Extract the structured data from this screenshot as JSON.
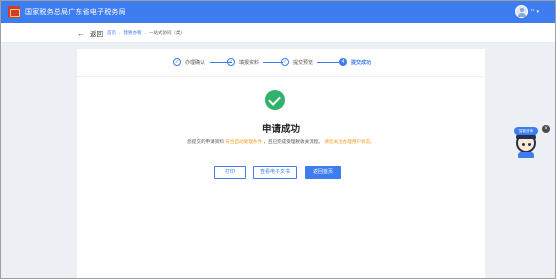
{
  "header": {
    "site_title": "国家税务总局广东省电子税务局",
    "user_name": "**",
    "caret": "▾"
  },
  "subheader": {
    "back_label": "返回",
    "breadcrumbs": [
      "首页",
      "我要办税",
      "一站式协同（类）"
    ]
  },
  "steps": [
    {
      "label": "办理确认",
      "icon": "✓",
      "active": false
    },
    {
      "label": "填报资料",
      "icon": "✓",
      "active": false
    },
    {
      "label": "提交预览",
      "icon": "✓",
      "active": false
    },
    {
      "label": "提交成功",
      "icon": "4",
      "active": true
    }
  ],
  "result": {
    "title": "申请成功",
    "desc_prefix": "您提交的申请资料",
    "desc_highlight1": "符合自动受理条件",
    "desc_middle": "，且已完成受理税收关流程。",
    "desc_highlight2": "请您关注办理用户状态。"
  },
  "buttons": {
    "print": "打印",
    "view_doc": "查看电子文书",
    "return_home": "返回首页"
  },
  "assistant": {
    "badge": "智能咨询",
    "close": "×"
  },
  "colors": {
    "primary": "#3d7df0",
    "success": "#2fb36a",
    "highlight": "#f29b1e"
  }
}
